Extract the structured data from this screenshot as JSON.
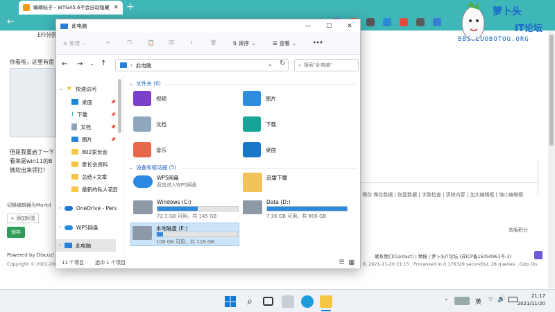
{
  "browser": {
    "tab_title": "编辑帖子 - WTGA5.6不会自动隐藏...",
    "new_tab": "+",
    "close_tab": "✕"
  },
  "page": {
    "efi_text": "EFI分区",
    "look_text": "你看啦，这里有盘",
    "but_text": "但是我重启了一下",
    "came_text": "看来是win11的B",
    "micro_text": "微软出来领打！",
    "switch_editor": "切换编辑器为Markd",
    "add_tag": "+ 添加标签",
    "save_btn": "保存",
    "editor_toolbar": "保存 保存数据 | 恢复数据 | 字数检查 | 清除内容 | 加大编辑框 | 缩小编辑框",
    "version_points": "本版积分",
    "powered_by": "Powered by Discuz!",
    "copyright": "Copyright © 2001-20",
    "contact_line": "联系我们(Contact) | 举报 | 萝卜头IT论坛 (苏ICP备15050961号-1)",
    "process_info": "8, 2021-11-20 21:15 , Processed in 0.176329 second(s), 28 queries , Gzip On."
  },
  "logo": {
    "line1": "萝卜头",
    "line2": "IT论坛",
    "url": "BBS.LUOBOTOU.ORG"
  },
  "explorer": {
    "title": "此电脑",
    "win_minimize": "—",
    "win_maximize": "☐",
    "win_close": "✕",
    "cmd_new": "新建",
    "cmd_sort": "排序",
    "cmd_view": "查看",
    "cmd_more": "•••",
    "address": "此电脑",
    "search_placeholder": "搜索\"此电脑\"",
    "nav": {
      "quick_access": "快速访问",
      "items": [
        {
          "label": "桌面"
        },
        {
          "label": "下载"
        },
        {
          "label": "文档"
        },
        {
          "label": "图片"
        },
        {
          "label": "802家长会"
        },
        {
          "label": "家长会资料"
        },
        {
          "label": "总结+文章"
        },
        {
          "label": "最新的私人花园"
        }
      ],
      "onedrive": "OneDrive - Pers",
      "wps": "WPS网盘",
      "this_pc": "此电脑"
    },
    "folders_section": "文件夹 (6)",
    "folders": [
      {
        "name": "视频"
      },
      {
        "name": "图片"
      },
      {
        "name": "文档"
      },
      {
        "name": "下载"
      },
      {
        "name": "音乐"
      },
      {
        "name": "桌面"
      }
    ],
    "drives_section": "设备和驱动器 (5)",
    "wps_drive": {
      "name": "WPS网盘",
      "sub": "双击进入WPS网盘"
    },
    "xunlei": {
      "name": "迅雷下载"
    },
    "drives": [
      {
        "name": "Windows (C:)",
        "sub": "72.3 GB 可用，共 145 GB",
        "used": 0.5
      },
      {
        "name": "Data (D:)",
        "sub": "7.36 GB 可用，共 806 GB",
        "used": 0.99
      },
      {
        "name": "本地磁盘 (E:)",
        "sub": "108 GB 可用，共 118 GB",
        "used": 0.08
      }
    ],
    "status_items": "11 个项目",
    "status_selected": "选中 1 个项目"
  },
  "taskbar": {
    "ime": "英",
    "time": "21:17",
    "date": "2021/11/20"
  },
  "colors": {
    "browser": "#3fb6b8",
    "accent": "#2c8bdf",
    "selection": "#cce4f7",
    "save_green": "#2e9d55"
  }
}
